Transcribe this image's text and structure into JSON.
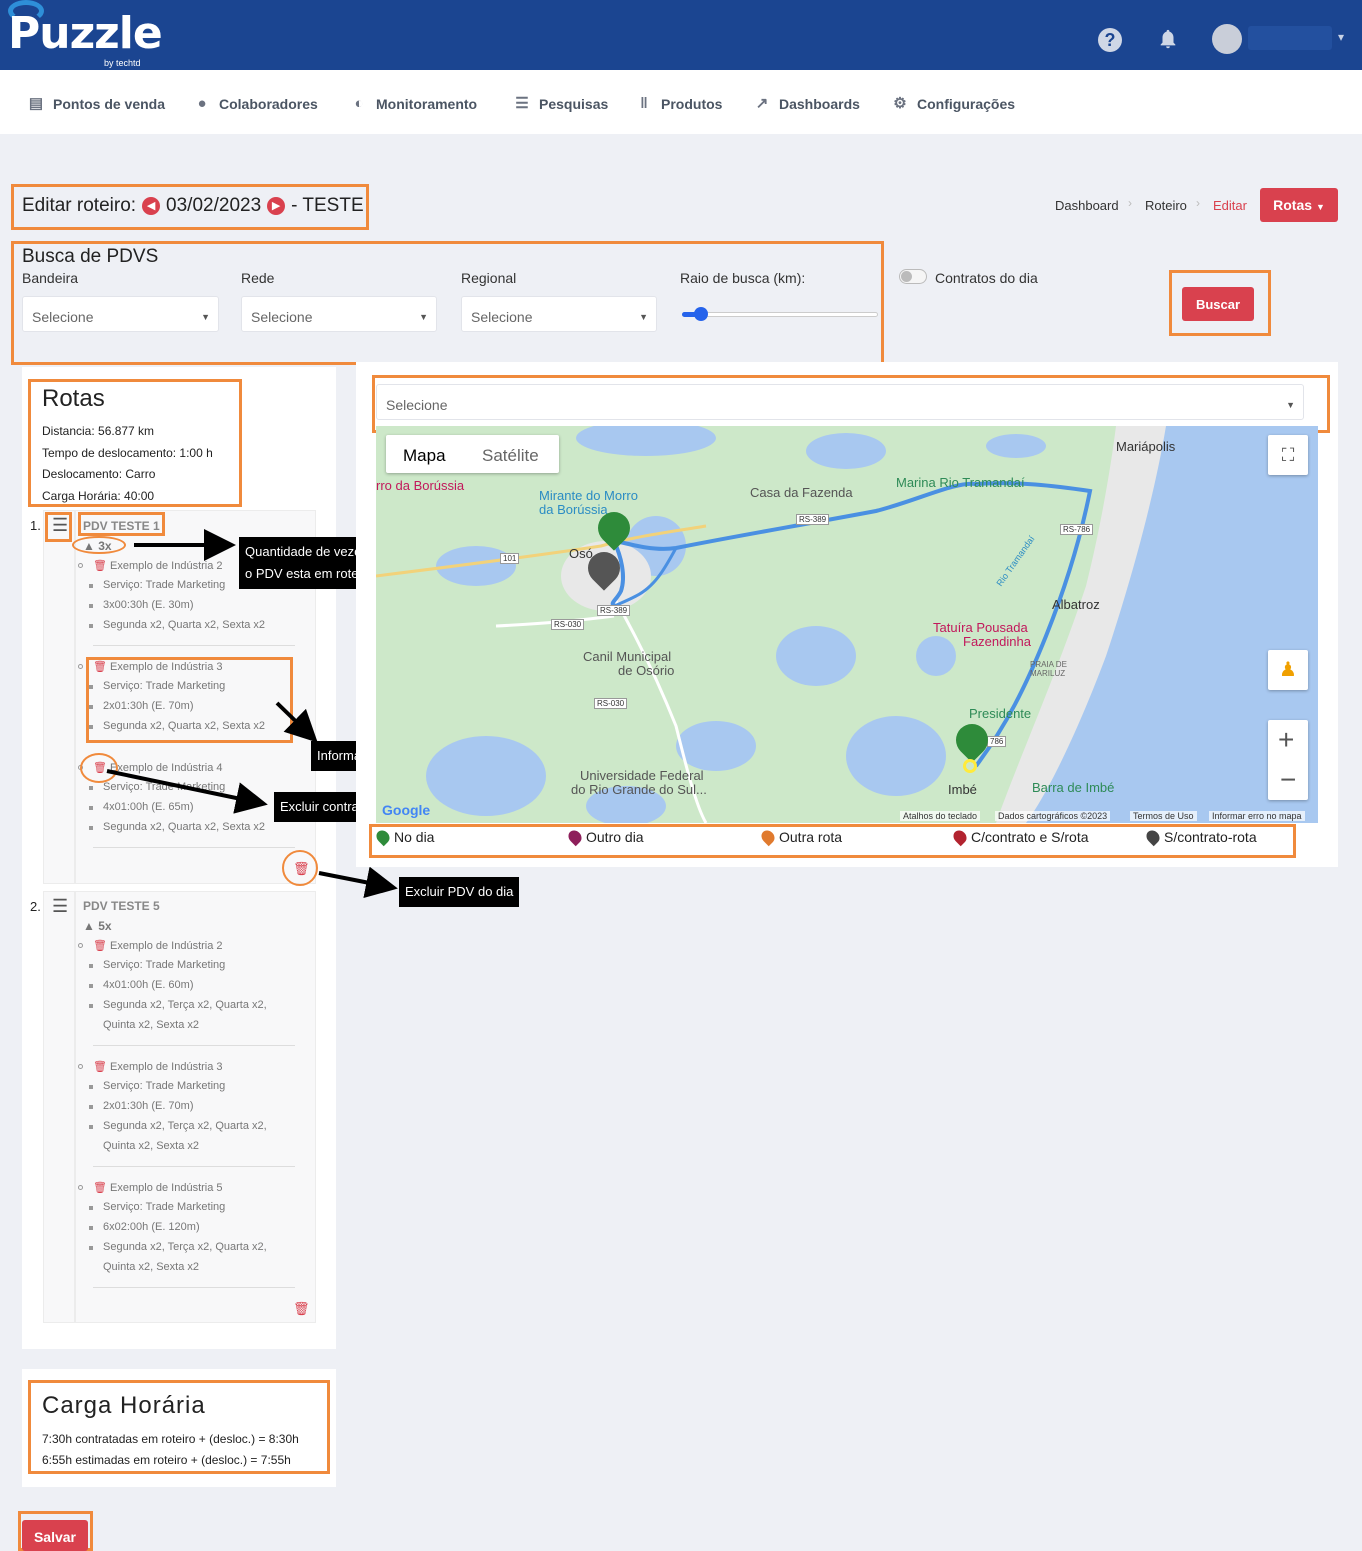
{
  "header": {
    "logo": "Puzzle",
    "logo_sub": "by techtd",
    "help_icon": "question-circle-icon",
    "bell_icon": "bell-icon"
  },
  "nav": {
    "items": [
      {
        "label": "Pontos de venda",
        "icon": "store-icon"
      },
      {
        "label": "Colaboradores",
        "icon": "users-icon"
      },
      {
        "label": "Monitoramento",
        "icon": "monitor-icon"
      },
      {
        "label": "Pesquisas",
        "icon": "clipboard-icon"
      },
      {
        "label": "Produtos",
        "icon": "barcode-icon"
      },
      {
        "label": "Dashboards",
        "icon": "chart-icon"
      },
      {
        "label": "Configurações",
        "icon": "gears-icon"
      }
    ]
  },
  "page": {
    "title_prefix": "Editar roteiro:",
    "date": "03/02/2023",
    "title_suffix": "- TESTE",
    "breadcrumb": [
      "Dashboard",
      "Roteiro",
      "Editar"
    ],
    "rotas_button": "Rotas"
  },
  "search": {
    "title": "Busca de PDVS",
    "bandeira_label": "Bandeira",
    "rede_label": "Rede",
    "regional_label": "Regional",
    "raio_label": "Raio de busca (km):",
    "raio_value": 0.08,
    "placeholder": "Selecione",
    "contratos_label": "Contratos do dia",
    "contratos_enabled": false,
    "buscar_button": "Buscar"
  },
  "rotas": {
    "title": "Rotas",
    "distancia": "Distancia: 56.877 km",
    "tempo": "Tempo de deslocamento: 1:00 h",
    "deslocamento": "Deslocamento: Carro",
    "carga": "Carga Horária: 40:00"
  },
  "pdvs": [
    {
      "num": "1.",
      "name": "PDV TESTE 1",
      "count": "3x",
      "contracts": [
        {
          "name": "Exemplo de Indústria 2",
          "servico": "Serviço: Trade Marketing",
          "tempo": "3x00:30h (E. 30m)",
          "dias": [
            "Segunda x2, Quarta x2, Sexta x2"
          ]
        },
        {
          "name": "Exemplo de Indústria 3",
          "servico": "Serviço: Trade Marketing",
          "tempo": "2x01:30h (E. 70m)",
          "dias": [
            "Segunda x2, Quarta x2, Sexta x2"
          ]
        },
        {
          "name": "Exemplo de Indústria 4",
          "servico": "Serviço: Trade Marketing",
          "tempo": "4x01:00h (E. 65m)",
          "dias": [
            "Segunda x2, Quarta x2, Sexta x2"
          ]
        }
      ]
    },
    {
      "num": "2.",
      "name": "PDV TESTE 5",
      "count": "5x",
      "contracts": [
        {
          "name": "Exemplo de Indústria 2",
          "servico": "Serviço: Trade Marketing",
          "tempo": "4x01:00h (E. 60m)",
          "dias": [
            "Segunda x2, Terça x2, Quarta x2,",
            "Quinta x2, Sexta x2"
          ]
        },
        {
          "name": "Exemplo de Indústria 3",
          "servico": "Serviço: Trade Marketing",
          "tempo": "2x01:30h (E. 70m)",
          "dias": [
            "Segunda x2, Terça x2, Quarta x2,",
            "Quinta x2, Sexta x2"
          ]
        },
        {
          "name": "Exemplo de Indústria 5",
          "servico": "Serviço: Trade Marketing",
          "tempo": "6x02:00h (E. 120m)",
          "dias": [
            "Segunda x2, Terça x2, Quarta x2,",
            "Quinta x2, Sexta x2"
          ]
        }
      ]
    }
  ],
  "tooltips": {
    "quantidade": [
      "Quantidade de vezes que",
      "o PDV esta em roteiro fixo."
    ],
    "info_contrato": "Informações do contrato",
    "excluir_contrato": "Excluir contrato do dia",
    "excluir_pdv": "Excluir PDV do dia"
  },
  "map": {
    "select_placeholder": "Selecione",
    "tab_map": "Mapa",
    "tab_sat": "Satélite",
    "places": {
      "mariapolis": "Mariápolis",
      "casa_fazenda": "Casa da Fazenda",
      "marina": "Marina Rio Tramandaí",
      "mirante": "Mirante do Morro",
      "mirante2": "da Borússia",
      "morro": "rro da Borússia",
      "osorio": "Osó",
      "albatroz": "Albatroz",
      "tatuira": "Tatuíra Pousada",
      "tatuira2": "Fazendinha",
      "canil": "Canil Municipal",
      "canil2": "de Osório",
      "presidente": "Presidente",
      "ufrgs": "Universidade Federal",
      "ufrgs2": "do Rio Grande do Sul...",
      "imbe": "Imbé",
      "barra": "Barra de Imbé",
      "rio": "Rio Tramandaí",
      "praia": "PRAIA DE",
      "praia2": "MARILUZ"
    },
    "roads": [
      "RS-389",
      "RS-786",
      "101",
      "RS-389",
      "RS-030",
      "RS-030",
      "786"
    ],
    "footer": [
      "Atalhos do teclado",
      "Dados cartográficos ©2023",
      "Termos de Uso",
      "Informar erro no mapa"
    ],
    "google": "Google"
  },
  "legend": [
    {
      "label": "No dia",
      "color": "#2e8b3a"
    },
    {
      "label": "Outro dia",
      "color": "#8e1f5b"
    },
    {
      "label": "Outra rota",
      "color": "#e07a2e"
    },
    {
      "label": "C/contrato e S/rota",
      "color": "#b2232f"
    },
    {
      "label": "S/contrato-rota",
      "color": "#444444"
    }
  ],
  "carga_horaria": {
    "title": "Carga Horária",
    "line1": "7:30h contratadas em roteiro + (desloc.) = 8:30h",
    "line2": "6:55h estimadas em roteiro + (desloc.) = 7:55h"
  },
  "salvar_button": "Salvar"
}
